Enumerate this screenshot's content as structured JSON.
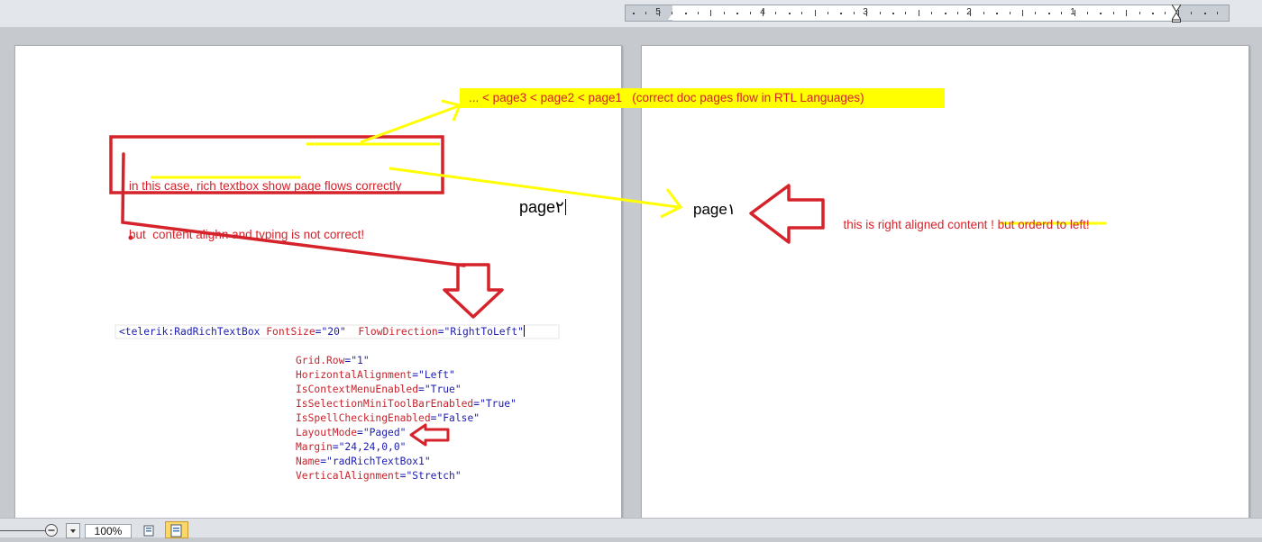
{
  "ruler": {
    "labels": [
      "5",
      "4",
      "3",
      "2",
      "1"
    ]
  },
  "zoom": {
    "value": "100%"
  },
  "pages": {
    "left": {
      "text": "page٢"
    },
    "right": {
      "text": "page١"
    }
  },
  "annotations": {
    "banner": "... < page3 < page2 < page1   (correct doc pages flow in RTL Languages)",
    "note_line1": "in this case, rich textbox show page flows correctly",
    "note_line2": "but  content alighn and typing is not correct!",
    "right_note_a": "this is right aligned content ! ",
    "right_note_b": "but orderd to left!"
  },
  "code": {
    "tag": "<telerik:RadRichTextBox",
    "attr1_name": "FontSize",
    "attr1_value": "\"20\"",
    "attr2_name": "FlowDirection",
    "attr2_value": "\"RightToLeft\"",
    "attributes": [
      {
        "name": "Grid.Row",
        "value": "\"1\""
      },
      {
        "name": "HorizontalAlignment",
        "value": "\"Left\""
      },
      {
        "name": "IsContextMenuEnabled",
        "value": "\"True\""
      },
      {
        "name": "IsSelectionMiniToolBarEnabled",
        "value": "\"True\""
      },
      {
        "name": "IsSpellCheckingEnabled",
        "value": "\"False\""
      },
      {
        "name": "LayoutMode",
        "value": "\"Paged\""
      },
      {
        "name": "Margin",
        "value": "\"24,24,0,0\""
      },
      {
        "name": "Name",
        "value": "\"radRichTextBox1\""
      },
      {
        "name": "VerticalAlignment",
        "value": "\"Stretch\""
      }
    ]
  },
  "colors": {
    "annotation_red": "#d6222a",
    "highlight_yellow": "#ffff00"
  }
}
